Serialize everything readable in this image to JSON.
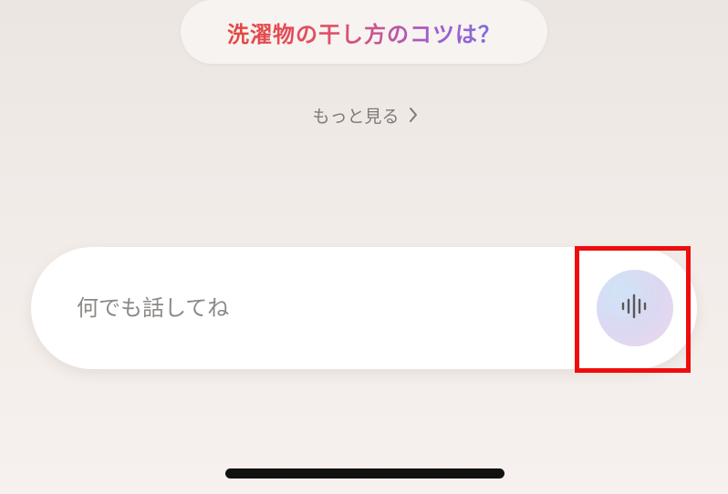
{
  "suggestion": {
    "text": "洗濯物の干し方のコツは？"
  },
  "more_link": {
    "label": "もっと見る",
    "icon": "chevron-right-icon"
  },
  "input": {
    "placeholder": "何でも話してね",
    "value": ""
  },
  "voice_button": {
    "icon": "voice-waveform-icon"
  },
  "colors": {
    "highlight": "#ee0d0d",
    "suggestion_gradient_start": "#e5473f",
    "suggestion_gradient_end": "#7b6ee0"
  }
}
